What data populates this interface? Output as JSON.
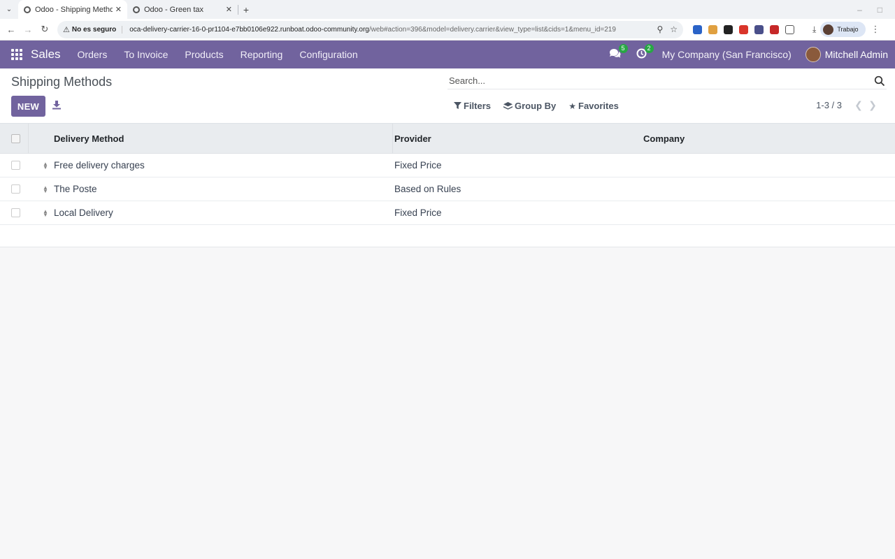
{
  "browser": {
    "tabs": [
      {
        "title": "Odoo - Shipping Metho",
        "active": true
      },
      {
        "title": "Odoo - Green tax",
        "active": false
      }
    ],
    "security_label": "No es seguro",
    "url_host": "oca-delivery-carrier-16-0-pr1104-e7bb0106e922.runboat.odoo-community.org",
    "url_path": "/web#action=396&model=delivery.carrier&view_type=list&cids=1&menu_id=219",
    "profile_label": "Trabajo"
  },
  "navbar": {
    "app_name": "Sales",
    "menu": [
      "Orders",
      "To Invoice",
      "Products",
      "Reporting",
      "Configuration"
    ],
    "messages_count": "5",
    "activities_count": "2",
    "company": "My Company (San Francisco)",
    "user": "Mitchell Admin"
  },
  "control_panel": {
    "title": "Shipping Methods",
    "new_label": "NEW",
    "search_placeholder": "Search...",
    "filters_label": "Filters",
    "groupby_label": "Group By",
    "favorites_label": "Favorites",
    "pager": "1-3 / 3"
  },
  "list": {
    "columns": [
      "Delivery Method",
      "Provider",
      "Company"
    ],
    "rows": [
      {
        "method": "Free delivery charges",
        "provider": "Fixed Price",
        "company": ""
      },
      {
        "method": "The Poste",
        "provider": "Based on Rules",
        "company": ""
      },
      {
        "method": "Local Delivery",
        "provider": "Fixed Price",
        "company": ""
      }
    ]
  },
  "colors": {
    "brand": "#71639e",
    "badge": "#28a745",
    "header_bg": "#e9ecef",
    "page_bg": "#f7f7f8"
  }
}
